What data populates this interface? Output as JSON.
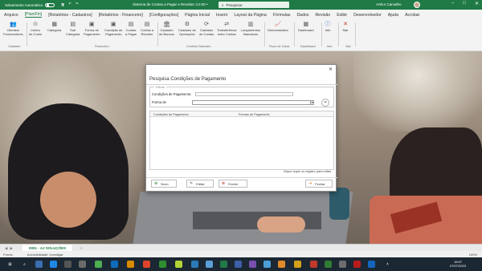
{
  "titlebar": {
    "autosave_label": "Salvamento Automático",
    "document_name": "Sistema de Contas a Pagar e Receber 3.0.00 •",
    "search_placeholder": "Pesquisar",
    "user_name": "Arthur Carvalho",
    "win_buttons": [
      "–",
      "□",
      "✕"
    ]
  },
  "menu": {
    "tabs": [
      "Arquivo",
      "[PlaniFin]",
      "[Relatórios - Cadastros]",
      "[Relatórios - Financeiro]",
      "[Configurações]",
      "Página Inicial",
      "Inserir",
      "Layout da Página",
      "Fórmulas",
      "Dados",
      "Revisão",
      "Exibir",
      "Desenvolvedor",
      "Ajuda",
      "Acrobat"
    ],
    "active_index": 1
  },
  "ribbon": {
    "buttons": [
      {
        "label": "Clientes/\nFornecedores",
        "icon": "people-icon"
      },
      {
        "label": "Centro\nde Custo",
        "icon": "cost-center-icon"
      },
      {
        "label": "Categoria",
        "icon": "category-icon"
      },
      {
        "label": "Sub\nCategoria",
        "icon": "subcategory-icon"
      },
      {
        "label": "Forma de\nPagamento",
        "icon": "payment-method-icon"
      },
      {
        "label": "Condição de\nPagamento",
        "icon": "payment-condition-icon"
      },
      {
        "label": "Contas\na Pagar",
        "icon": "payables-icon"
      },
      {
        "label": "Contas a\nReceber",
        "icon": "receivables-icon"
      },
      {
        "label": "Cadastro\nde Bancos",
        "icon": "bank-icon"
      },
      {
        "label": "Cadastro de\nOperações",
        "icon": "operations-icon"
      },
      {
        "label": "Cadastro\nde Contas",
        "icon": "accounts-icon"
      },
      {
        "label": "Transferência\nentre Contas",
        "icon": "transfer-icon"
      },
      {
        "label": "Lançamentos\nBancários",
        "icon": "bank-entries-icon"
      },
      {
        "label": "Demonstrativo",
        "icon": "chart-icon"
      },
      {
        "label": "Dashboard",
        "icon": "dashboard-icon"
      },
      {
        "label": "Info",
        "icon": "info-icon"
      },
      {
        "label": "Sair",
        "icon": "exit-icon"
      }
    ],
    "groups": [
      "Cadastro",
      "Financeiro",
      "Controle Bancário",
      "Fluxo de Caixa",
      "Dashboard",
      "Info",
      "Sair"
    ]
  },
  "dialog": {
    "title": "Pesquisa Condições de Pagamento",
    "filters_legend": "Filtros",
    "condition_label": "Condições de Pagamento:",
    "method_label": "Forma de",
    "grid_headers": [
      "Condições de Pagamento",
      "Formas de Pagamento"
    ],
    "hint": "Clique duplo no registro para editar",
    "buttons": {
      "new": "Novo",
      "edit": "Editar",
      "delete": "Excluir",
      "close": "Fechar"
    }
  },
  "sheetbar": {
    "tab": "0001 - AJ SOLUÇÕES",
    "add": "+"
  },
  "status": {
    "ready": "Pronto",
    "accessibility": "Acessibilidade: investigar",
    "zoom": "100%"
  },
  "taskbar": {
    "time": "16:57",
    "date": "07/07/2023"
  },
  "colors": {
    "excel_green": "#1f7a45",
    "taskbar": "#1b2733"
  }
}
